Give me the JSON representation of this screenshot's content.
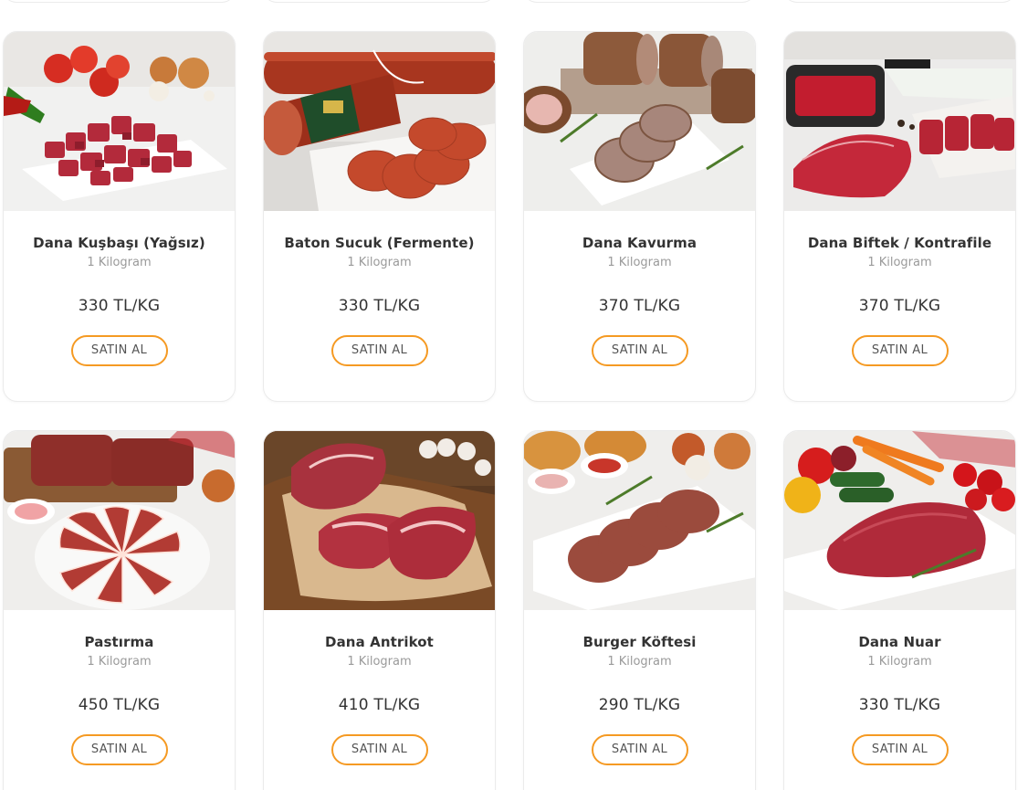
{
  "colors": {
    "accent": "#f59a23",
    "title_text": "#333333",
    "unit_text": "#9a9a9a",
    "card_border": "#ebebeb"
  },
  "products": [
    {
      "title": "Dana Kuşbaşı (Yağsız)",
      "unit": "1 Kilogram",
      "price": "330 TL/KG",
      "buy_label": "SATIN AL"
    },
    {
      "title": "Baton Sucuk (Fermente)",
      "unit": "1 Kilogram",
      "price": "330 TL/KG",
      "buy_label": "SATIN AL"
    },
    {
      "title": "Dana Kavurma",
      "unit": "1 Kilogram",
      "price": "370 TL/KG",
      "buy_label": "SATIN AL"
    },
    {
      "title": "Dana Biftek / Kontrafile",
      "unit": "1 Kilogram",
      "price": "370 TL/KG",
      "buy_label": "SATIN AL"
    },
    {
      "title": "Pastırma",
      "unit": "1 Kilogram",
      "price": "450 TL/KG",
      "buy_label": "SATIN AL"
    },
    {
      "title": "Dana Antrikot",
      "unit": "1 Kilogram",
      "price": "410 TL/KG",
      "buy_label": "SATIN AL"
    },
    {
      "title": "Burger Köftesi",
      "unit": "1 Kilogram",
      "price": "290 TL/KG",
      "buy_label": "SATIN AL"
    },
    {
      "title": "Dana Nuar",
      "unit": "1 Kilogram",
      "price": "330 TL/KG",
      "buy_label": "SATIN AL"
    }
  ]
}
